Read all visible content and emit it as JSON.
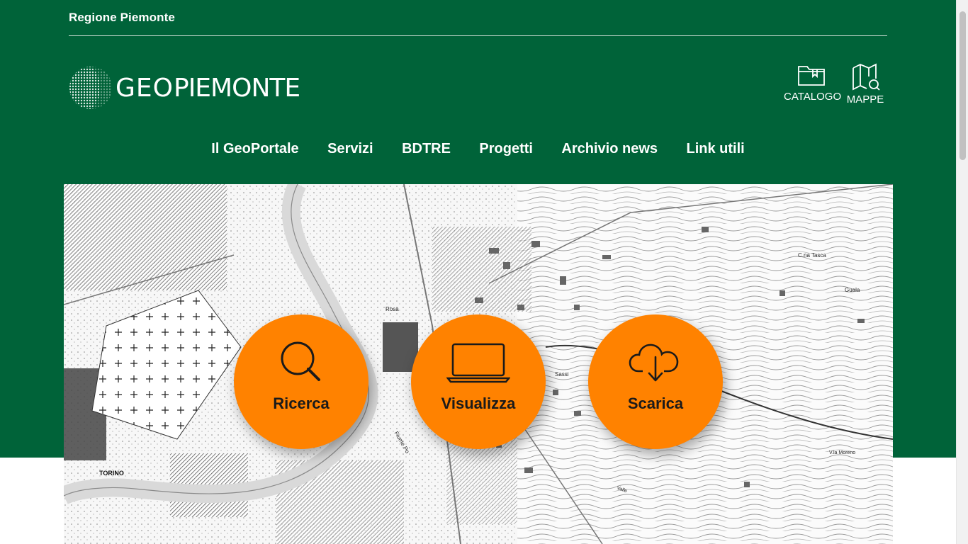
{
  "header": {
    "region_link": "Regione Piemonte",
    "logo": {
      "geo": "GEO",
      "name": "PIEMONTE"
    },
    "tools": [
      {
        "label": "CATALOGO",
        "icon": "folder-bookmark-icon"
      },
      {
        "label": "MAPPE",
        "icon": "map-search-icon"
      }
    ]
  },
  "nav": {
    "items": [
      "Il GeoPortale",
      "Servizi",
      "BDTRE",
      "Progetti",
      "Archivio news",
      "Link utili"
    ]
  },
  "hero": {
    "map_labels": [
      "TORINO",
      "Rosa",
      "Sassi",
      "Fiume Po",
      "C.na Tasca",
      "Guala",
      "V.la Moreno",
      "Valle"
    ],
    "actions": [
      {
        "label": "Ricerca",
        "icon": "magnifier-icon"
      },
      {
        "label": "Visualizza",
        "icon": "laptop-icon"
      },
      {
        "label": "Scarica",
        "icon": "cloud-download-icon"
      }
    ]
  },
  "colors": {
    "brand_green": "#006339",
    "accent_orange": "#ff8200"
  }
}
